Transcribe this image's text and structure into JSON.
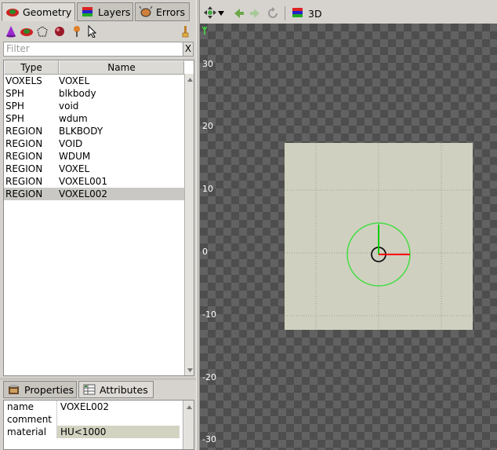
{
  "left_panel": {
    "tabs": [
      {
        "label": "Geometry",
        "icon": "geometry-icon",
        "active": true
      },
      {
        "label": "Layers",
        "icon": "layers-icon",
        "active": false
      },
      {
        "label": "Errors",
        "icon": "errors-icon",
        "active": false
      }
    ],
    "toolbar": [
      "cone-icon",
      "geometry-add-icon",
      "region-icon",
      "sphere-icon",
      "material-icon",
      "pointer-icon",
      "paint-brush-icon"
    ],
    "filter": {
      "placeholder": "Filter",
      "clear_label": "X"
    },
    "table": {
      "columns": [
        "Type",
        "Name"
      ],
      "rows": [
        {
          "type": "VOXELS",
          "name": "VOXEL"
        },
        {
          "type": "SPH",
          "name": "blkbody"
        },
        {
          "type": "SPH",
          "name": "void"
        },
        {
          "type": "SPH",
          "name": "wdum"
        },
        {
          "type": "REGION",
          "name": "BLKBODY"
        },
        {
          "type": "REGION",
          "name": "VOID"
        },
        {
          "type": "REGION",
          "name": "WDUM"
        },
        {
          "type": "REGION",
          "name": "VOXEL"
        },
        {
          "type": "REGION",
          "name": "VOXEL001"
        },
        {
          "type": "REGION",
          "name": "VOXEL002"
        }
      ],
      "selected_index": 9
    },
    "bottom_tabs": [
      {
        "label": "Properties",
        "icon": "properties-icon",
        "active": false
      },
      {
        "label": "Attributes",
        "icon": "attributes-icon",
        "active": true
      }
    ],
    "attributes": [
      {
        "key": "name",
        "value": "VOXEL002"
      },
      {
        "key": "comment",
        "value": ""
      },
      {
        "key": "material",
        "value": "HU<1000"
      }
    ]
  },
  "viewport": {
    "toolbar": {
      "view_label": "3D"
    },
    "y_ticks": [
      "30",
      "20",
      "10",
      "0",
      "-10",
      "-20",
      "-30"
    ],
    "colors": {
      "plane": "#d0d0c0",
      "x_axis": "#ff0000",
      "y_axis": "#00cc00",
      "circle": "#44dd44"
    }
  }
}
